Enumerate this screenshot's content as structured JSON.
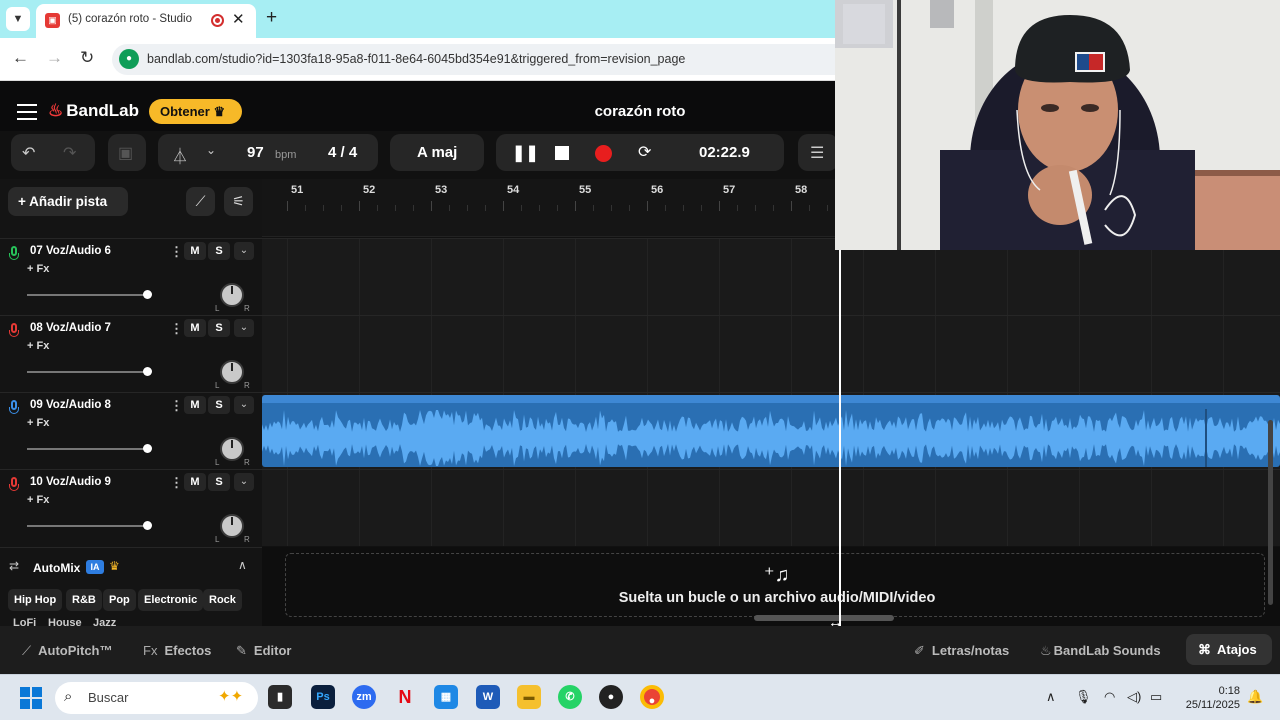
{
  "browser": {
    "tab_title": "(5) corazón roto - Studio",
    "url": "bandlab.com/studio?id=1303fa18-95a8-f011-8e64-6045bd354e91&triggered_from=revision_page"
  },
  "header": {
    "logo_text": "BandLab",
    "obtener_label": "Obtener",
    "project_title": "corazón roto"
  },
  "transport": {
    "bpm_value": "97",
    "bpm_unit": "bpm",
    "time_signature": "4 / 4",
    "key": "A maj",
    "time": "02:22.9",
    "record_color": "#e81e1e"
  },
  "left_panel": {
    "add_track_label": "Añadir pista",
    "tracks": [
      {
        "name": "07  Voz/Audio 6",
        "fx": "+ Fx",
        "mute": "M",
        "solo": "S",
        "mic_color": "#27c25a",
        "pan_l": "L",
        "pan_r": "R"
      },
      {
        "name": "08  Voz/Audio 7",
        "fx": "+ Fx",
        "mute": "M",
        "solo": "S",
        "mic_color": "#e53935",
        "pan_l": "L",
        "pan_r": "R"
      },
      {
        "name": "09  Voz/Audio 8",
        "fx": "+ Fx",
        "mute": "M",
        "solo": "S",
        "mic_color": "#3b8fe8",
        "pan_l": "L",
        "pan_r": "R"
      },
      {
        "name": "10  Voz/Audio 9",
        "fx": "+ Fx",
        "mute": "M",
        "solo": "S",
        "mic_color": "#e53935",
        "pan_l": "L",
        "pan_r": "R"
      }
    ],
    "automix": {
      "title": "AutoMix",
      "ia_badge": "IA",
      "genres": [
        "Hip Hop",
        "R&B",
        "Pop",
        "Electronic",
        "Rock"
      ],
      "genres_row2": [
        "LoFi",
        "House",
        "Jazz"
      ]
    }
  },
  "timeline": {
    "bar_numbers": [
      "51",
      "52",
      "53",
      "54",
      "55",
      "56",
      "57",
      "58"
    ],
    "drop_text": "Suelta un bucle o un archivo audio/MIDI/video",
    "clip_color": "#2a6fb3"
  },
  "bottom_bar": {
    "autopitch": "AutoPitch™",
    "efectos": "Efectos",
    "editor": "Editor",
    "letras": "Letras/notas",
    "sounds": "BandLab Sounds",
    "atajos": "Atajos"
  },
  "taskbar": {
    "search_placeholder": "Buscar",
    "time": "0:18",
    "date": "25/11/2025"
  }
}
